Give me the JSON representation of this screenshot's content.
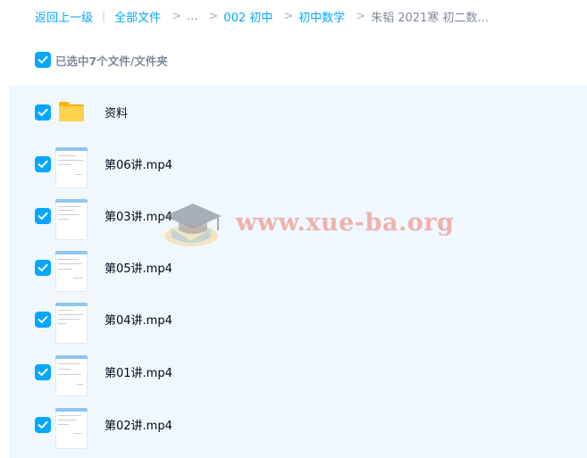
{
  "breadcrumb": {
    "back": "返回上一级",
    "separator": "|",
    "items": [
      {
        "label": "全部文件"
      },
      {
        "label": "..."
      },
      {
        "label": "002 初中"
      },
      {
        "label": "初中数学"
      },
      {
        "label": "朱韬 2021寒 初二数..."
      }
    ],
    "chevron": ">"
  },
  "selection": {
    "label": "已选中7个文件/文件夹",
    "checked": true
  },
  "files": [
    {
      "name": "资料",
      "type": "folder",
      "checked": true
    },
    {
      "name": "第06讲.mp4",
      "type": "video",
      "checked": true
    },
    {
      "name": "第03讲.mp4",
      "type": "video",
      "checked": true
    },
    {
      "name": "第05讲.mp4",
      "type": "video",
      "checked": true
    },
    {
      "name": "第04讲.mp4",
      "type": "video",
      "checked": true
    },
    {
      "name": "第01讲.mp4",
      "type": "video",
      "checked": true
    },
    {
      "name": "第02讲.mp4",
      "type": "video",
      "checked": true
    }
  ],
  "watermark": {
    "text": "www.xue-ba.org",
    "icon": "graduation-cap-icon"
  },
  "colors": {
    "accent": "#06a7ff",
    "list_background": "#f0f8fe",
    "muted_text": "#818999",
    "folder": "#ffc53d"
  }
}
